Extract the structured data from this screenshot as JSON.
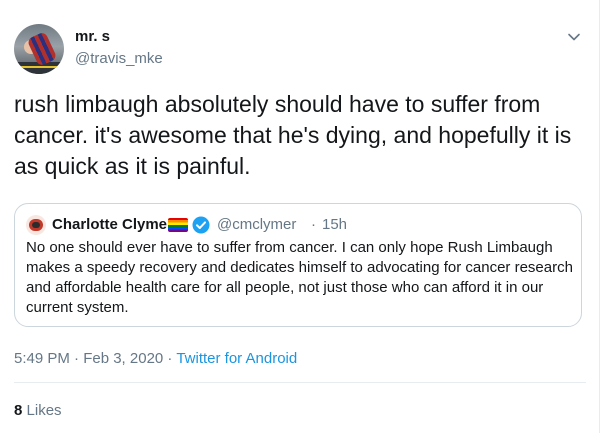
{
  "tweet": {
    "author": {
      "display_name": "mr. s",
      "handle": "@travis_mke"
    },
    "text": "rush limbaugh absolutely should have to suffer from cancer. it's awesome that he's dying, and hopefully it is as quick as it is painful.",
    "quoted": {
      "display_name": "Charlotte Clymer",
      "handle": "@cmclymer",
      "separator": "·",
      "time": "15h",
      "text": "No one should ever have to suffer from cancer. I can only hope Rush Limbaugh makes a speedy recovery and dedicates himself to advocating for cancer research and affordable health care for all people, not just those who can afford it in our current system.",
      "badges": [
        "rainbow-flag-icon",
        "verified-icon"
      ]
    },
    "meta": {
      "timestamp": "5:49 PM · Feb 3, 2020",
      "separator": " · ",
      "source": "Twitter for Android"
    },
    "stats": {
      "likes_count": "8",
      "likes_label": "Likes"
    }
  },
  "colors": {
    "text": "#14171a",
    "secondary": "#657786",
    "link": "#1b95e0",
    "border": "#ccd6dd",
    "verified": "#1da1f2"
  },
  "icons": {
    "menu": "chevron-down-icon"
  }
}
